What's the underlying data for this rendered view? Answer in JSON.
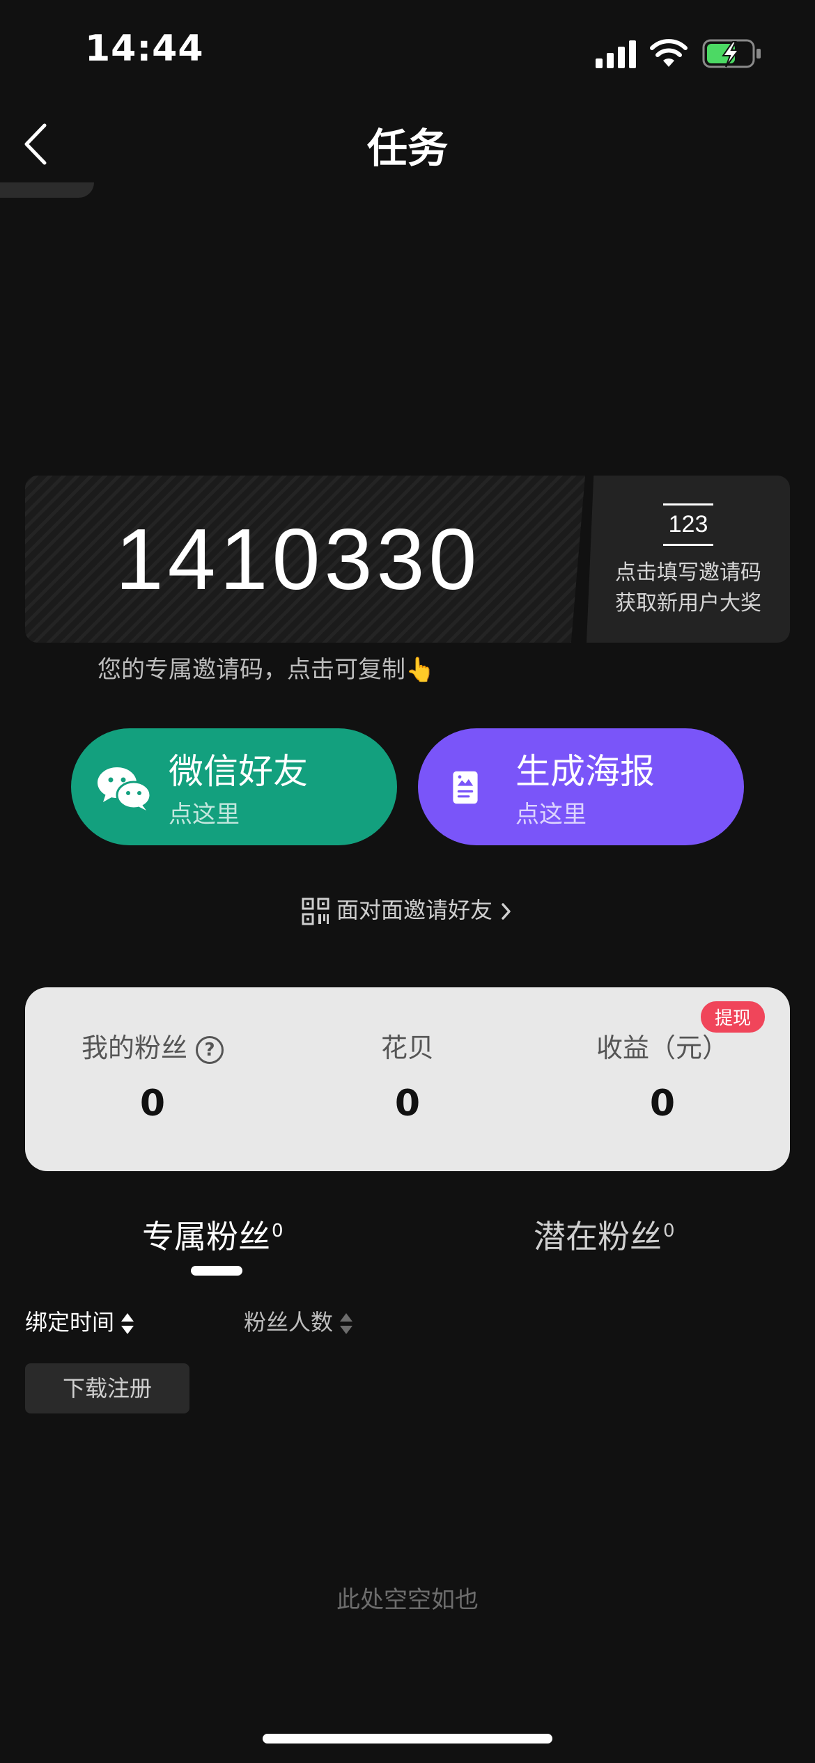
{
  "status_bar": {
    "time": "14:44"
  },
  "nav": {
    "title": "任务"
  },
  "invite": {
    "code": "1410330",
    "hint": "您的专属邀请码，点击可复制👆",
    "side_code": "123",
    "side_line1": "点击填写邀请码",
    "side_line2": "获取新用户大奖"
  },
  "share": {
    "wechat": {
      "title": "微信好友",
      "sub": "点这里"
    },
    "poster": {
      "title": "生成海报",
      "sub": "点这里"
    },
    "face_to_face": "面对面邀请好友"
  },
  "stats": {
    "withdraw": "提现",
    "fans": {
      "label": "我的粉丝",
      "value": "0"
    },
    "huabei": {
      "label": "花贝",
      "value": "0"
    },
    "earnings": {
      "label": "收益（元）",
      "value": "0"
    }
  },
  "tabs": {
    "exclusive": {
      "label": "专属粉丝",
      "count": "0"
    },
    "potential": {
      "label": "潜在粉丝",
      "count": "0"
    }
  },
  "sort": {
    "bind_time": "绑定时间",
    "fan_count": "粉丝人数"
  },
  "filter": {
    "download_register": "下载注册"
  },
  "empty": "此处空空如也",
  "colors": {
    "wechat_green": "#13a07e",
    "poster_purple": "#7a55f9",
    "badge_red": "#f0455a",
    "battery_green": "#4cd964"
  }
}
